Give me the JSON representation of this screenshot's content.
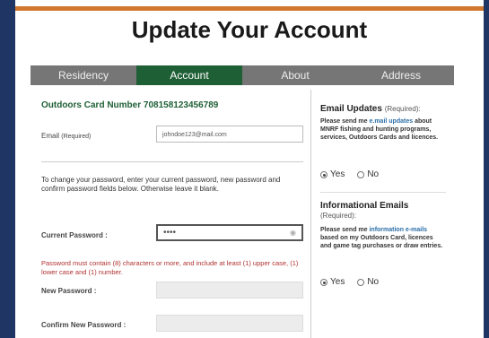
{
  "page": {
    "title": "Update Your Account"
  },
  "tabs": [
    {
      "label": "Residency"
    },
    {
      "label": "Account"
    },
    {
      "label": "About"
    },
    {
      "label": "Address"
    }
  ],
  "account": {
    "card_label": "Outdoors Card Number",
    "card_number": "708158123456789",
    "email_label": "Email",
    "email_required": "(Required)",
    "email_value": "johndoe123@mail.com",
    "password_note": "To change your password, enter your current password, new password and confirm password fields below. Otherwise leave it blank.",
    "current_password_label": "Current Password :",
    "current_password_value": "••••",
    "password_rule": "Password must contain (8) characters or more, and include at least (1) upper case, (1) lower case and (1) number.",
    "new_password_label": "New Password :",
    "confirm_password_label": "Confirm New Password :"
  },
  "email_updates": {
    "heading": "Email Updates",
    "required": "(Required):",
    "text_pre": "Please send me ",
    "text_link": "e.mail updates",
    "text_post": " about MNRF fishing and hunting programs, services, Outdoors Cards and licences.",
    "yes": "Yes",
    "no": "No",
    "selected": "yes"
  },
  "info_emails": {
    "heading": "Informational Emails",
    "required": "(Required):",
    "text_pre": "Please send me ",
    "text_link": "information e-mails",
    "text_post": " based on my Outdoors Card, licences and game tag purchases or draw entries.",
    "yes": "Yes",
    "no": "No",
    "selected": "yes"
  },
  "colors": {
    "navy": "#1f3564",
    "orange": "#d2772e",
    "green": "#1f5f35",
    "tab_gray": "#767676",
    "warn_red": "#b03030"
  }
}
